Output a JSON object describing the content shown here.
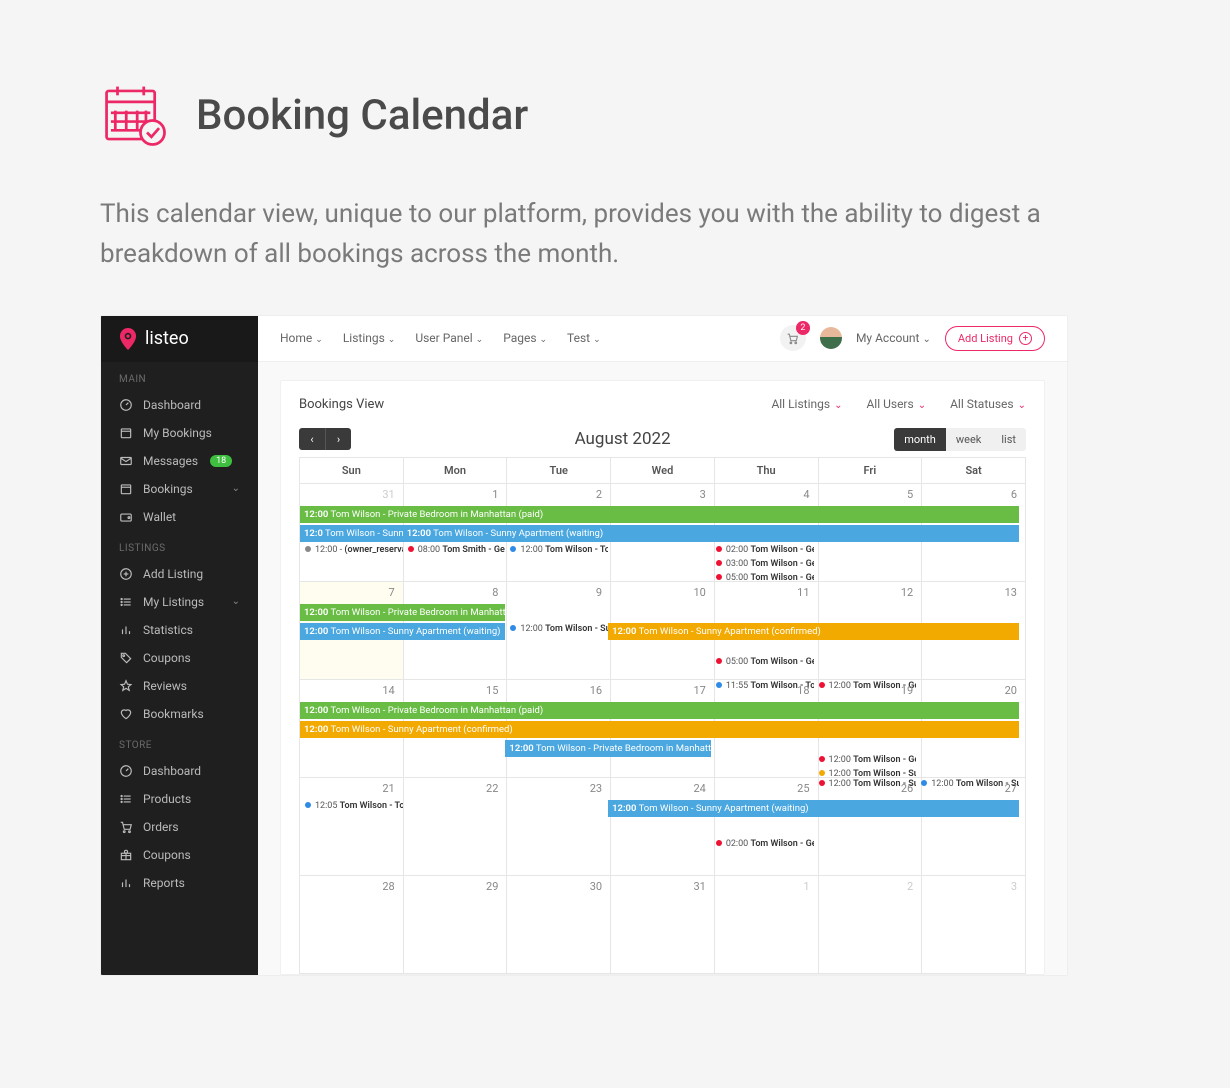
{
  "hero": {
    "title": "Booking Calendar",
    "desc": "This calendar view, unique to our platform, provides you with the ability to digest a breakdown of all bookings across the month."
  },
  "brand": "listeo",
  "sidebar": {
    "sections": [
      {
        "head": "MAIN",
        "items": [
          {
            "label": "Dashboard",
            "icon": "gauge"
          },
          {
            "label": "My Bookings",
            "icon": "cal"
          },
          {
            "label": "Messages",
            "icon": "mail",
            "badge": "18"
          },
          {
            "label": "Bookings",
            "icon": "cal",
            "chev": true
          },
          {
            "label": "Wallet",
            "icon": "wallet"
          }
        ]
      },
      {
        "head": "LISTINGS",
        "items": [
          {
            "label": "Add Listing",
            "icon": "plus"
          },
          {
            "label": "My Listings",
            "icon": "list",
            "chev": true
          },
          {
            "label": "Statistics",
            "icon": "stats"
          },
          {
            "label": "Coupons",
            "icon": "tag"
          },
          {
            "label": "Reviews",
            "icon": "star"
          },
          {
            "label": "Bookmarks",
            "icon": "heart"
          }
        ]
      },
      {
        "head": "STORE",
        "items": [
          {
            "label": "Dashboard",
            "icon": "gauge"
          },
          {
            "label": "Products",
            "icon": "list"
          },
          {
            "label": "Orders",
            "icon": "cart"
          },
          {
            "label": "Coupons",
            "icon": "gift"
          },
          {
            "label": "Reports",
            "icon": "stats"
          }
        ]
      }
    ]
  },
  "topnav": [
    "Home",
    "Listings",
    "User Panel",
    "Pages",
    "Test"
  ],
  "cart_count": "2",
  "account_label": "My Account",
  "add_listing_label": "Add Listing",
  "card": {
    "title": "Bookings View",
    "filters": [
      "All Listings",
      "All Users",
      "All Statuses"
    ],
    "month": "August 2022",
    "views": [
      "month",
      "week",
      "list"
    ],
    "active_view": "month",
    "days": [
      "Sun",
      "Mon",
      "Tue",
      "Wed",
      "Thu",
      "Fri",
      "Sat"
    ]
  },
  "weeks": [
    {
      "nums": [
        "31",
        "1",
        "2",
        "3",
        "4",
        "5",
        "6"
      ],
      "gray": [
        0
      ],
      "bars": [
        {
          "cls": "green",
          "span": [
            0,
            7
          ],
          "time": "12:00",
          "txt": "Tom Wilson - Private Bedroom in Manhattan (paid)"
        },
        {
          "cls": "blue",
          "span": [
            0,
            1
          ],
          "time": "12:0",
          "txt": "Tom Wilson - Sunny Apt"
        },
        {
          "cls": "blue",
          "span": [
            1,
            6
          ],
          "time": "12:00",
          "txt": "Tom Wilson - Sunny Apartment (waiting)"
        }
      ],
      "dots": {
        "0": [
          {
            "c": "gray",
            "t": "12:00 -",
            "l": "(owner_reservatio"
          }
        ],
        "1": [
          {
            "c": "red",
            "t": "08:00",
            "l": "Tom Smith - Georg"
          }
        ],
        "2": [
          {
            "c": "blue",
            "t": "12:00",
            "l": "Tom Wilson - Tom&"
          }
        ],
        "4": [
          {
            "c": "red",
            "t": "02:00",
            "l": "Tom Wilson - Geor"
          },
          {
            "c": "red",
            "t": "03:00",
            "l": "Tom Wilson - Geor"
          },
          {
            "c": "red",
            "t": "05:00",
            "l": "Tom Wilson - Geor"
          }
        ]
      }
    },
    {
      "nums": [
        "7",
        "8",
        "9",
        "10",
        "11",
        "12",
        "13"
      ],
      "shade": [
        0
      ],
      "bars": [
        {
          "cls": "green",
          "span": [
            0,
            2
          ],
          "time": "12:00",
          "txt": "Tom Wilson - Private Bedroom in Manhattan (paid)"
        },
        {
          "cls": "blue",
          "span": [
            0,
            2
          ],
          "time": "12:00",
          "txt": "Tom Wilson - Sunny Apartment (waiting)"
        },
        {
          "cls": "orange",
          "span": [
            3,
            4
          ],
          "row": 1,
          "time": "12:00",
          "txt": "Tom Wilson - Sunny Apartment (confirmed)"
        }
      ],
      "dots": {
        "2": [
          {
            "c": "blue",
            "t": "12:00",
            "l": "Tom Wilson - Sunn",
            "off": 1
          }
        ],
        "4": [
          {
            "c": "blue",
            "t": "11:55",
            "l": "Tom Wilson - Tom&",
            "off": 2
          },
          {
            "c": "red",
            "t": "05:00",
            "l": "Tom Wilson - Geor"
          }
        ],
        "5": [
          {
            "c": "red",
            "t": "12:00",
            "l": "Tom Wilson - Geor",
            "off": 2
          }
        ]
      }
    },
    {
      "nums": [
        "14",
        "15",
        "16",
        "17",
        "18",
        "19",
        "20"
      ],
      "bars": [
        {
          "cls": "green",
          "span": [
            0,
            7
          ],
          "time": "12:00",
          "txt": "Tom Wilson - Private Bedroom in Manhattan (paid)"
        },
        {
          "cls": "orange",
          "span": [
            0,
            7
          ],
          "time": "12:00",
          "txt": "Tom Wilson - Sunny Apartment (confirmed)"
        },
        {
          "cls": "blue",
          "span": [
            2,
            2
          ],
          "row": 2,
          "time": "12:00",
          "txt": "Tom Wilson - Private Bedroom in Manhattan (wait"
        }
      ],
      "dots": {
        "5": [
          {
            "c": "red",
            "t": "12:00",
            "l": "Tom Wilson - Sunn",
            "off": 2
          },
          {
            "c": "red",
            "t": "12:00",
            "l": "Tom Wilson - Geor"
          },
          {
            "c": "orange",
            "t": "12:00",
            "l": "Tom Wilson - Sunn"
          }
        ],
        "6": [
          {
            "c": "blue",
            "t": "12:00",
            "l": "Tom Wilson - Sunn",
            "off": 2
          }
        ]
      }
    },
    {
      "nums": [
        "21",
        "22",
        "23",
        "24",
        "25",
        "26",
        "27"
      ],
      "bars": [
        {
          "cls": "blue",
          "span": [
            3,
            4
          ],
          "row": 0,
          "time": "12:00",
          "txt": "Tom Wilson - Sunny Apartment (waiting)"
        }
      ],
      "dots": {
        "0": [
          {
            "c": "blue",
            "t": "12:05",
            "l": "Tom Wilson - Tom&"
          }
        ],
        "4": [
          {
            "c": "red",
            "t": "02:00",
            "l": "Tom Wilson - Geor",
            "off": 1
          }
        ]
      }
    },
    {
      "nums": [
        "28",
        "29",
        "30",
        "31",
        "1",
        "2",
        "3"
      ],
      "gray": [
        4,
        5,
        6
      ],
      "bars": [],
      "dots": {}
    }
  ],
  "icons": {
    "ch": "⌄"
  }
}
